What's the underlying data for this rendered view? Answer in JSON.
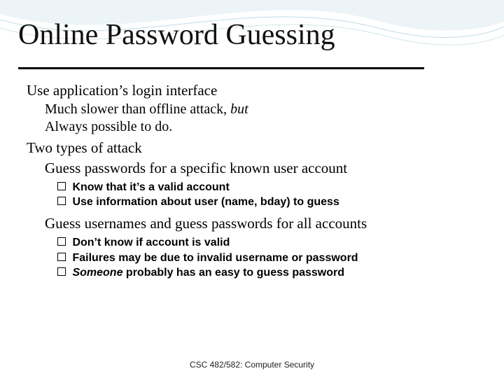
{
  "title": "Online Password Guessing",
  "p1": "Use application’s login interface",
  "p1a_pre": "Much slower than offline attack, ",
  "p1a_it": "but",
  "p1b": "Always possible to do.",
  "p2": "Two types of attack",
  "p2a": "Guess passwords for a specific known user account",
  "b1": " Know that it’s a valid account",
  "b2": " Use information about user (name, bday) to guess",
  "p2b": "Guess usernames and guess passwords for all accounts",
  "b3": " Don’t know if account is valid",
  "b4": " Failures may be due to invalid username or password",
  "b5_it": " Someone",
  "b5_rest": " probably has an easy to guess password",
  "footer": "CSC 482/582: Computer Security"
}
